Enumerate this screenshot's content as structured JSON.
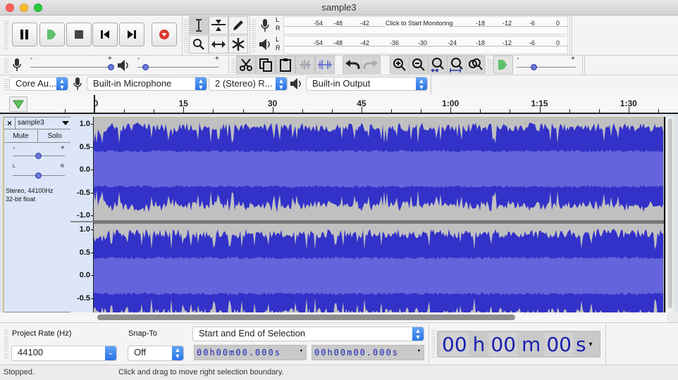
{
  "window": {
    "title": "sample3"
  },
  "transport": {
    "buttons": [
      {
        "name": "pause",
        "label": "Pause"
      },
      {
        "name": "play",
        "label": "Play"
      },
      {
        "name": "stop",
        "label": "Stop"
      },
      {
        "name": "skip-to-start",
        "label": "Skip to Start"
      },
      {
        "name": "skip-to-end",
        "label": "Skip to End"
      },
      {
        "name": "record",
        "label": "Record"
      }
    ]
  },
  "tools": [
    "selection",
    "envelope",
    "draw",
    "zoom",
    "time-shift",
    "multi"
  ],
  "meters": {
    "record": {
      "channels": [
        "L",
        "R"
      ],
      "ticks": [
        "-54",
        "-48",
        "-42",
        "-18",
        "-12",
        "-6",
        "0"
      ],
      "prompt": "Click to Start Monitoring"
    },
    "playback": {
      "channels": [
        "L",
        "R"
      ],
      "ticks": [
        "-54",
        "-48",
        "-42",
        "-36",
        "-30",
        "-24",
        "-18",
        "-12",
        "-6",
        "0"
      ]
    }
  },
  "mixer": {
    "minus": "-",
    "plus": "+",
    "record_volume": 1.0,
    "playback_volume": 0.1
  },
  "play_at_speed": {
    "minus": "-",
    "plus": "+",
    "speed": 0.3
  },
  "device": {
    "host": "Core Au...",
    "input": "Built-in Microphone",
    "channels": "2 (Stereo) R...",
    "output": "Built-in Output"
  },
  "ruler": {
    "labels": [
      "0",
      "15",
      "30",
      "45",
      "1:00",
      "1:15",
      "1:30"
    ]
  },
  "track": {
    "name": "sample3",
    "close": "×",
    "mute": "Mute",
    "solo": "Solo",
    "gain_minus": "-",
    "gain_plus": "+",
    "pan_left": "L",
    "pan_right": "R",
    "gain": 0.5,
    "pan": 0.5,
    "info_line1": "Stereo, 44100Hz",
    "info_line2": "32-bit float",
    "scale_top": [
      "1.0",
      "0.5",
      "0.0",
      "-0.5",
      "-1.0"
    ],
    "scale_bottom": [
      "1.0",
      "0.5",
      "0.0",
      "-0.5"
    ],
    "colors": {
      "wave": "#3232c8",
      "rms": "#6464dc",
      "bg": "#c0c0c0"
    }
  },
  "bottom": {
    "project_rate_label": "Project Rate (Hz)",
    "project_rate": "44100",
    "snap_label": "Snap-To",
    "snap": "Off",
    "selection_mode": "Start and End of Selection",
    "sel_start": "00h00m00.000s",
    "sel_end": "00h00m00.000s",
    "audio_pos": [
      "00",
      "h",
      "00",
      "m",
      "00",
      "s"
    ]
  },
  "status": {
    "state": "Stopped.",
    "hint": "Click and drag to move right selection boundary."
  }
}
